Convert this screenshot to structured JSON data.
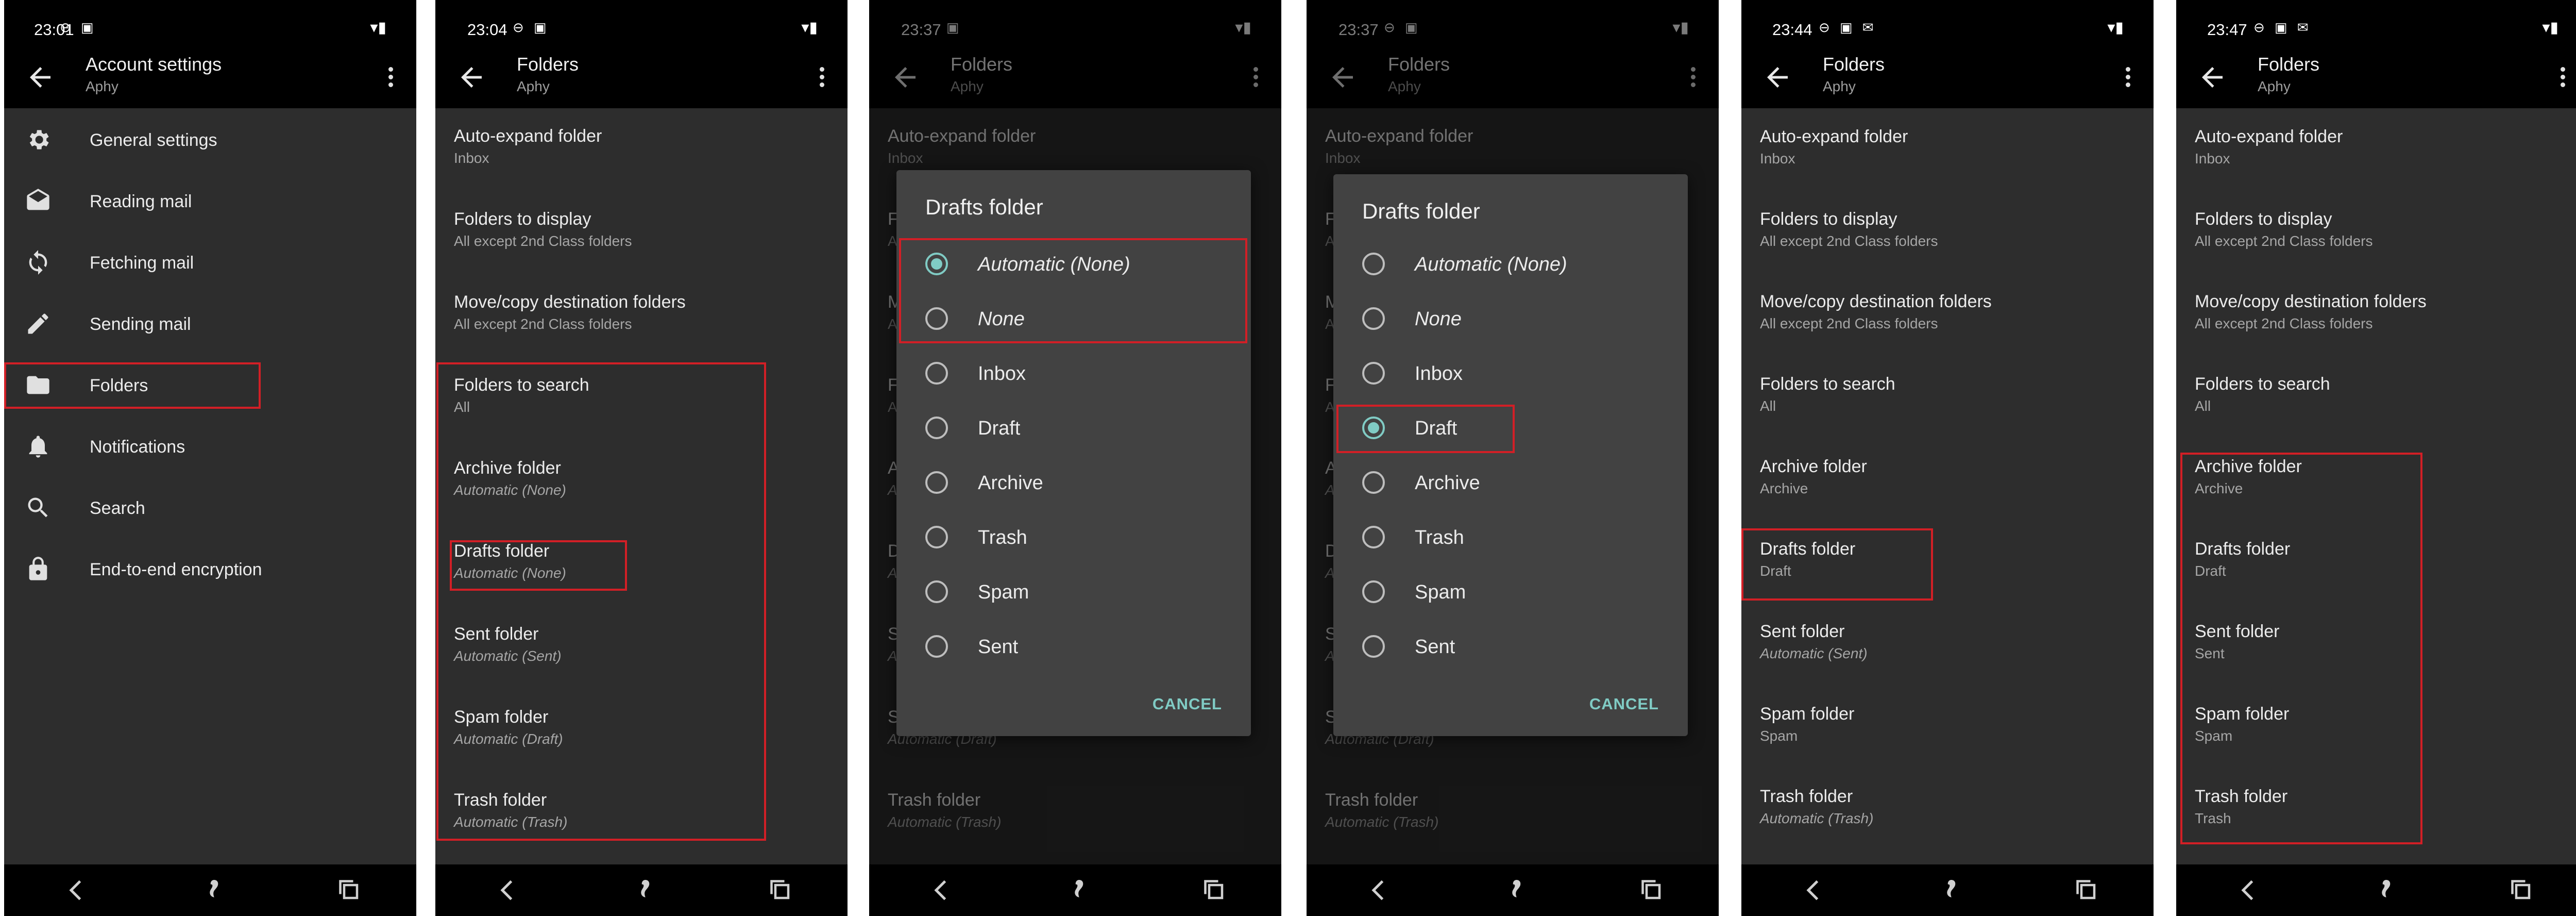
{
  "panels": [
    {
      "status_time": "23:01",
      "toolbar": {
        "title": "Account settings",
        "subtitle": "Aphy"
      },
      "menu": [
        {
          "label": "General settings",
          "icon": "gear-icon"
        },
        {
          "label": "Reading mail",
          "icon": "envelope-open-icon"
        },
        {
          "label": "Fetching mail",
          "icon": "sync-icon"
        },
        {
          "label": "Sending mail",
          "icon": "pencil-icon"
        },
        {
          "label": "Folders",
          "icon": "folder-icon"
        },
        {
          "label": "Notifications",
          "icon": "bell-icon"
        },
        {
          "label": "Search",
          "icon": "search-icon"
        },
        {
          "label": "End-to-end encryption",
          "icon": "lock-icon"
        }
      ]
    },
    {
      "status_time": "23:04",
      "toolbar": {
        "title": "Folders",
        "subtitle": "Aphy"
      },
      "prefs": [
        {
          "title": "Auto-expand folder",
          "summary": "Inbox"
        },
        {
          "title": "Folders to display",
          "summary": "All except 2nd Class folders"
        },
        {
          "title": "Move/copy destination folders",
          "summary": "All except 2nd Class folders"
        },
        {
          "title": "Folders to search",
          "summary": "All"
        },
        {
          "title": "Archive folder",
          "summary": "Automatic (None)"
        },
        {
          "title": "Drafts folder",
          "summary": "Automatic (None)"
        },
        {
          "title": "Sent folder",
          "summary": "Automatic (Sent)"
        },
        {
          "title": "Spam folder",
          "summary": "Automatic (Draft)"
        },
        {
          "title": "Trash folder",
          "summary": "Automatic (Trash)"
        }
      ]
    },
    {
      "status_time": "23:37",
      "toolbar": {
        "title": "Folders",
        "subtitle": "Aphy"
      },
      "prefs": [
        {
          "title": "Auto-expand folder",
          "summary": "Inbox"
        },
        {
          "title": "Folders to display",
          "summary": "All except 2nd Class folders"
        },
        {
          "title": "Move/copy destination folders",
          "summary": "All except 2nd Class folders"
        },
        {
          "title": "Folders to search",
          "summary": "All"
        },
        {
          "title": "Archive folder",
          "summary": "Automatic (None)"
        },
        {
          "title": "Drafts folder",
          "summary": "Automatic (None)"
        },
        {
          "title": "Sent folder",
          "summary": "Automatic (Sent)"
        },
        {
          "title": "Spam folder",
          "summary": "Automatic (Draft)"
        },
        {
          "title": "Trash folder",
          "summary": "Automatic (Trash)"
        }
      ],
      "dialog": {
        "title": "Drafts folder",
        "options": [
          "Automatic (None)",
          "None",
          "Inbox",
          "Draft",
          "Archive",
          "Trash",
          "Spam",
          "Sent"
        ],
        "selected": "Automatic (None)",
        "cancel_label": "CANCEL"
      }
    },
    {
      "status_time": "23:37",
      "toolbar": {
        "title": "Folders",
        "subtitle": "Aphy"
      },
      "prefs": [
        {
          "title": "Auto-expand folder",
          "summary": "Inbox"
        },
        {
          "title": "Folders to display",
          "summary": "All except 2nd Class folders"
        },
        {
          "title": "Move/copy destination folders",
          "summary": "All except 2nd Class folders"
        },
        {
          "title": "Folders to search",
          "summary": "All"
        },
        {
          "title": "Archive folder",
          "summary": "Automatic (None)"
        },
        {
          "title": "Drafts folder",
          "summary": "Automatic (None)"
        },
        {
          "title": "Sent folder",
          "summary": "Automatic (Sent)"
        },
        {
          "title": "Spam folder",
          "summary": "Automatic (Draft)"
        },
        {
          "title": "Trash folder",
          "summary": "Automatic (Trash)"
        }
      ],
      "dialog": {
        "title": "Drafts folder",
        "options": [
          "Automatic (None)",
          "None",
          "Inbox",
          "Draft",
          "Archive",
          "Trash",
          "Spam",
          "Sent"
        ],
        "selected": "Draft",
        "cancel_label": "CANCEL"
      }
    },
    {
      "status_time": "23:44",
      "toolbar": {
        "title": "Folders",
        "subtitle": "Aphy"
      },
      "prefs": [
        {
          "title": "Auto-expand folder",
          "summary": "Inbox"
        },
        {
          "title": "Folders to display",
          "summary": "All except 2nd Class folders"
        },
        {
          "title": "Move/copy destination folders",
          "summary": "All except 2nd Class folders"
        },
        {
          "title": "Folders to search",
          "summary": "All"
        },
        {
          "title": "Archive folder",
          "summary": "Archive"
        },
        {
          "title": "Drafts folder",
          "summary": "Draft"
        },
        {
          "title": "Sent folder",
          "summary": "Automatic (Sent)"
        },
        {
          "title": "Spam folder",
          "summary": "Spam"
        },
        {
          "title": "Trash folder",
          "summary": "Automatic (Trash)"
        }
      ]
    },
    {
      "status_time": "23:47",
      "toolbar": {
        "title": "Folders",
        "subtitle": "Aphy"
      },
      "prefs": [
        {
          "title": "Auto-expand folder",
          "summary": "Inbox"
        },
        {
          "title": "Folders to display",
          "summary": "All except 2nd Class folders"
        },
        {
          "title": "Move/copy destination folders",
          "summary": "All except 2nd Class folders"
        },
        {
          "title": "Folders to search",
          "summary": "All"
        },
        {
          "title": "Archive folder",
          "summary": "Archive"
        },
        {
          "title": "Drafts folder",
          "summary": "Draft"
        },
        {
          "title": "Sent folder",
          "summary": "Sent"
        },
        {
          "title": "Spam folder",
          "summary": "Spam"
        },
        {
          "title": "Trash folder",
          "summary": "Trash"
        }
      ]
    }
  ],
  "colors": {
    "background": "#2d2d2d",
    "bars": "#000000",
    "accent": "#80cbc4",
    "highlight": "#d21f26",
    "dialog": "#424242"
  }
}
